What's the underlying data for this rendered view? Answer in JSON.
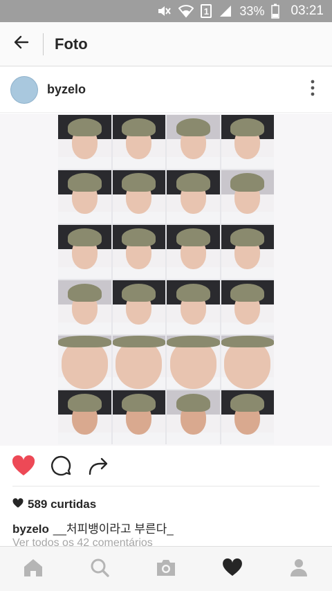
{
  "status_bar": {
    "battery": "33%",
    "time": "03:21",
    "sim": "1",
    "icons": [
      "mute-icon",
      "wifi-icon",
      "sim-icon",
      "signal-icon",
      "battery-icon"
    ]
  },
  "app_bar": {
    "title": "Foto",
    "back_icon": "arrow-left-icon"
  },
  "post": {
    "username": "byzelo",
    "more_icon": "more-vertical-icon",
    "photo_grid": {
      "columns": 4,
      "rows": 6
    },
    "like_active_color": "#ed4956",
    "likes_text": "589 curtidas",
    "caption_user": "byzelo",
    "caption_text": "__처피뱅이라고 부른다_",
    "comments_link": "Ver todos os 42 comentários"
  },
  "bottom_nav": {
    "items": [
      "home-icon",
      "search-icon",
      "camera-icon",
      "heart-icon",
      "profile-icon"
    ],
    "active": "heart-icon"
  }
}
